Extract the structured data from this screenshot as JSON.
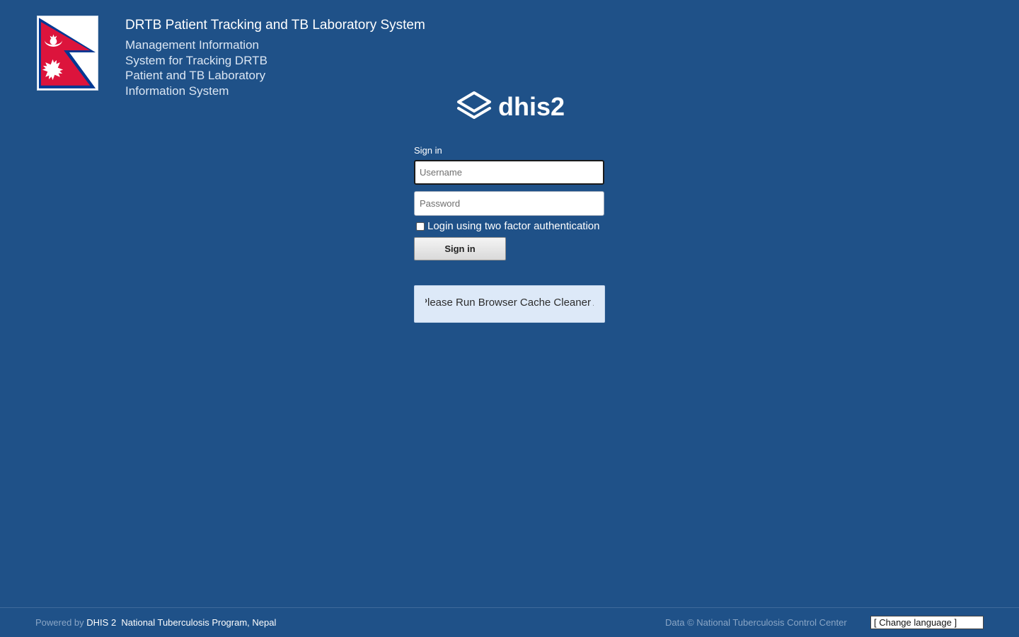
{
  "header": {
    "title": "DRTB Patient Tracking and TB Laboratory System",
    "description": "Management Information System for Tracking DRTB Patient and TB Laboratory Information System"
  },
  "brand": {
    "logo_text": "dhis2"
  },
  "login": {
    "heading": "Sign in",
    "username_placeholder": "Username",
    "password_placeholder": "Password",
    "two_factor_label": "Login using two factor authentication",
    "two_factor_checked": false,
    "submit_label": "Sign in"
  },
  "notice": {
    "text": "Please Run Browser Cache Cleaner App"
  },
  "footer": {
    "powered_by": "Powered by",
    "dhis_link": "DHIS 2",
    "program_link": "National Tuberculosis Program, Nepal",
    "copyright": "Data © National Tuberculosis Control Center",
    "language_select": "[ Change language ]"
  },
  "colors": {
    "background": "#1f5188",
    "flag_red": "#dc143c",
    "flag_blue": "#003893",
    "notice_bg": "#dde9f8"
  }
}
